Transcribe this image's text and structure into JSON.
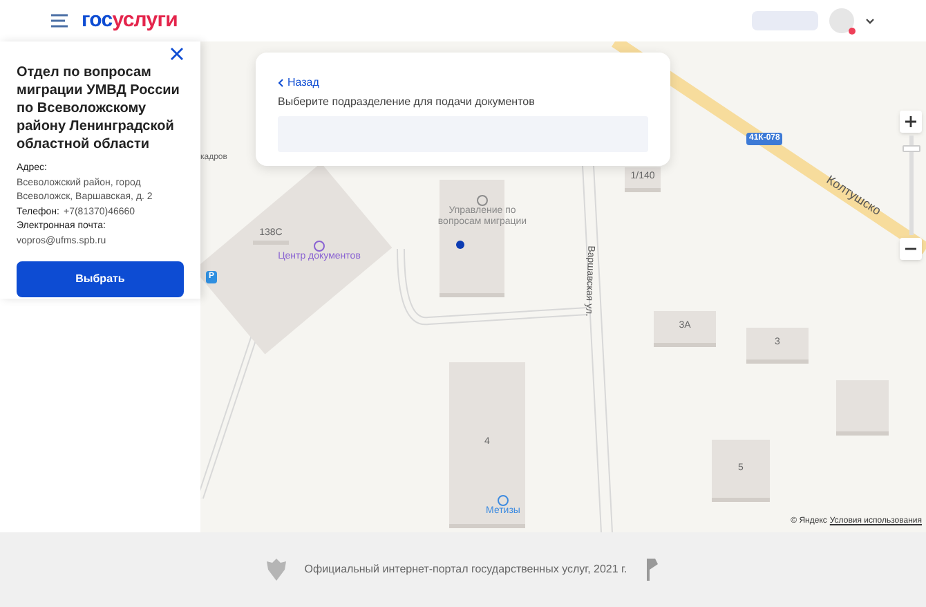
{
  "header": {
    "logo": {
      "part_1": "гос",
      "part_2": "услуги"
    },
    "notification": true
  },
  "panel": {
    "title": "Отдел по вопросам миграции УМВД России по Всеволожскому району Ленинградской областной области",
    "details": [
      {
        "label": "Адрес:",
        "value": "Всеволожский район, город Всеволожск, Варшавская, д. 2"
      },
      {
        "label": "Телефон:",
        "value": "+7(81370)46660"
      },
      {
        "label": "Электронная почта:",
        "value": "vopros@ufms.spb.ru"
      }
    ],
    "button": "Выбрать"
  },
  "card": {
    "back": "Назад",
    "prompt": "Выберите подразделение для подачи документов"
  },
  "map": {
    "buildings": [
      "138С",
      "1/140",
      "3А",
      "3",
      "4",
      "5"
    ],
    "pois": [
      {
        "name": "Центр документов",
        "color": "#8a63d2"
      },
      {
        "name": "Управление по вопросам миграции",
        "color": "#8a8a8a"
      },
      {
        "name": "Метизы",
        "color": "#3d8be0"
      }
    ],
    "streets": [
      "Варшавская ул.",
      "Колтушско"
    ],
    "route_badge": "41К-078",
    "fragment": "кадров",
    "parking": "P",
    "zoom": {
      "level": 0.9
    },
    "attribution": "© Яндекс",
    "terms": "Условия использования"
  },
  "footer": {
    "text": "Официальный интернет-портал государственных услуг, 2021 г."
  }
}
